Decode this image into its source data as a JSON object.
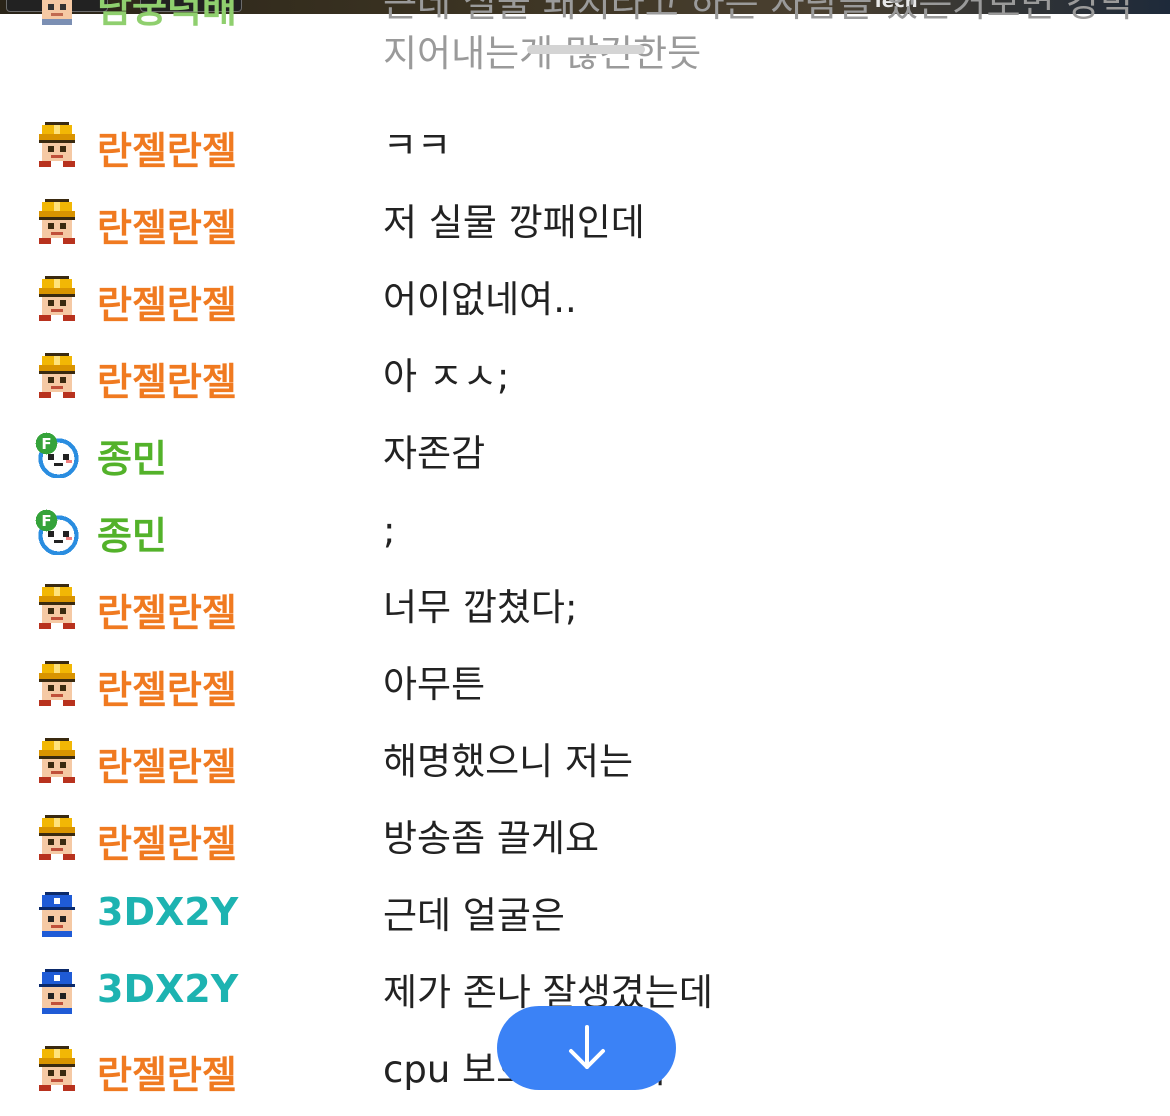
{
  "chat": {
    "partial_top": {
      "nickname": "남궁덕배",
      "message": "근데 실물 돼지라고 하는 사람들 있는거보면 강막 지어내는게 많긴한듯"
    },
    "messages": [
      {
        "nickname": "란젤란젤",
        "avatar": "hardhat-worker",
        "message": "ㅋㅋ"
      },
      {
        "nickname": "란젤란젤",
        "avatar": "hardhat-worker",
        "message": "저 실물 깡패인데"
      },
      {
        "nickname": "란젤란젤",
        "avatar": "hardhat-worker",
        "message": "어이없네여.."
      },
      {
        "nickname": "란젤란젤",
        "avatar": "hardhat-worker",
        "message": "아 ㅈㅅ;"
      },
      {
        "nickname": "종민",
        "avatar": "panda-fan",
        "message": "자존감"
      },
      {
        "nickname": "종민",
        "avatar": "panda-fan",
        "message": ";"
      },
      {
        "nickname": "란젤란젤",
        "avatar": "hardhat-worker",
        "message": "너무 깝쳤다;"
      },
      {
        "nickname": "란젤란젤",
        "avatar": "hardhat-worker",
        "message": "아무튼"
      },
      {
        "nickname": "란젤란젤",
        "avatar": "hardhat-worker",
        "message": "해명했으니 저는"
      },
      {
        "nickname": "란젤란젤",
        "avatar": "hardhat-worker",
        "message": "방송좀 끌게요"
      },
      {
        "nickname": "3DX2Y",
        "avatar": "blue-cap",
        "message": "근데 얼굴은"
      },
      {
        "nickname": "3DX2Y",
        "avatar": "blue-cap",
        "message": "제가 존나 잘생겼는데"
      },
      {
        "nickname": "란젤란젤",
        "avatar": "hardhat-worker",
        "message": "cpu 보호해야해서"
      }
    ]
  },
  "video_strip": {
    "text": "Tech"
  },
  "scroll_button": {
    "icon": "arrow-down-icon",
    "color": "#3b82f6"
  },
  "colors": {
    "nick_orange": "#f07a20",
    "nick_green": "#53b22a",
    "nick_teal": "#1db3b1",
    "message_text": "#222222"
  }
}
